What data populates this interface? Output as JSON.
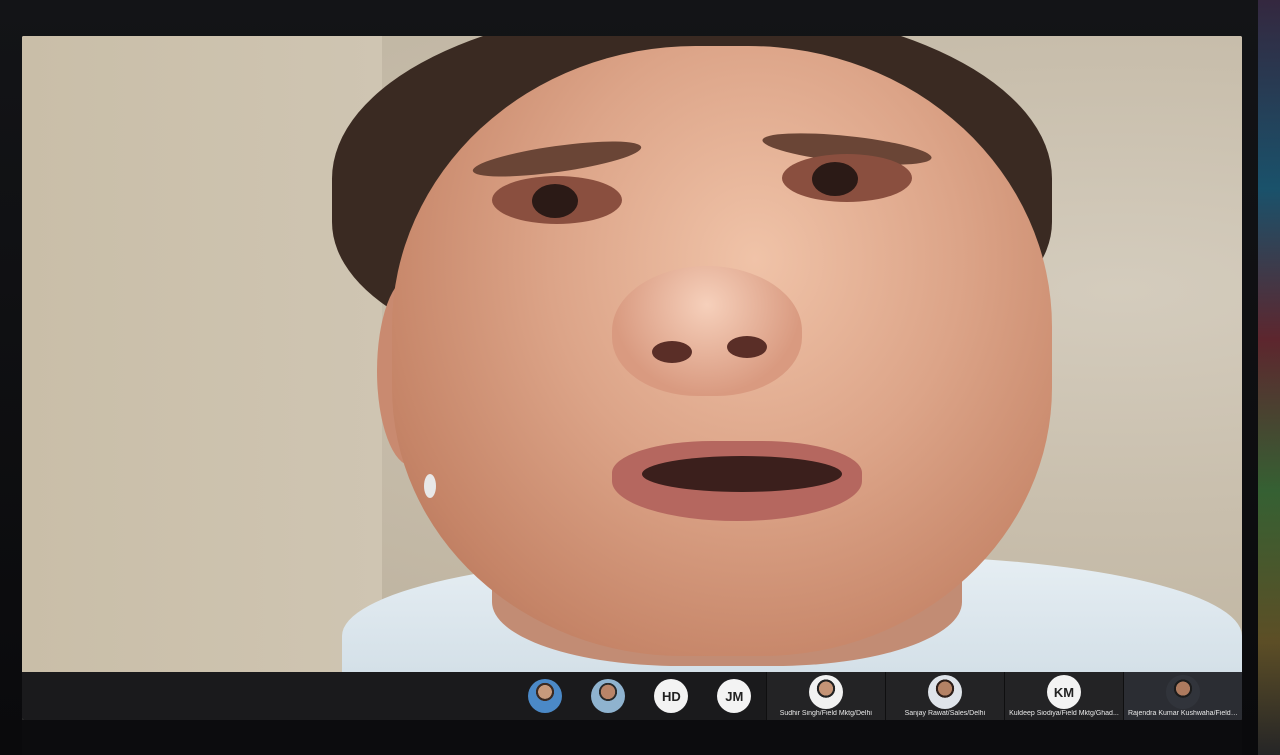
{
  "participants": [
    {
      "initials": "",
      "avatar": "photo",
      "name": ""
    },
    {
      "initials": "",
      "avatar": "photo2",
      "name": ""
    },
    {
      "initials": "HD",
      "avatar": "initials",
      "name": ""
    },
    {
      "initials": "JM",
      "avatar": "initials",
      "name": ""
    },
    {
      "initials": "",
      "avatar": "photo3",
      "name": "Sudhir Singh/Field Mktg/Delhi"
    },
    {
      "initials": "",
      "avatar": "photo4",
      "name": "Sanjay Rawat/Sales/Delhi"
    },
    {
      "initials": "KM",
      "avatar": "initials",
      "name": "Kuldeep Siodiya/Field Mktg/Ghad..."
    },
    {
      "initials": "",
      "avatar": "photo5",
      "name": "Rajendra Kumar Kushwaha/Field M..."
    }
  ]
}
